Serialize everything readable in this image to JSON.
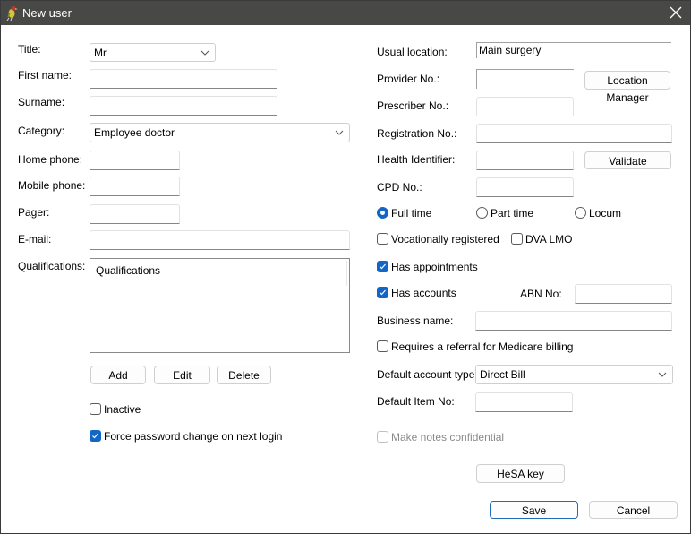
{
  "window": {
    "title": "New user",
    "app_icon": "bird-app-icon",
    "close_icon": "close-icon"
  },
  "left": {
    "title": {
      "label": "Title:",
      "value": "Mr"
    },
    "first_name": {
      "label": "First name:",
      "value": ""
    },
    "surname": {
      "label": "Surname:",
      "value": ""
    },
    "category": {
      "label": "Category:",
      "value": "Employee doctor"
    },
    "home_phone": {
      "label": "Home phone:",
      "value": ""
    },
    "mobile_phone": {
      "label": "Mobile phone:",
      "value": ""
    },
    "pager": {
      "label": "Pager:",
      "value": ""
    },
    "email": {
      "label": "E-mail:",
      "value": ""
    },
    "qualifications": {
      "label": "Qualifications:",
      "items": [
        "Qualifications"
      ]
    },
    "buttons": {
      "add": "Add",
      "edit": "Edit",
      "delete": "Delete"
    },
    "inactive": {
      "label": "Inactive",
      "checked": false
    },
    "force_password": {
      "label": "Force password change on next login",
      "checked": true
    }
  },
  "right": {
    "usual_location": {
      "label": "Usual location:",
      "value": "Main surgery"
    },
    "provider_no": {
      "label": "Provider No.:",
      "value": ""
    },
    "location_manager_button": "Location Manager",
    "prescriber_no": {
      "label": "Prescriber No.:",
      "value": ""
    },
    "registration_no": {
      "label": "Registration No.:",
      "value": ""
    },
    "health_identifier": {
      "label": "Health Identifier:",
      "value": ""
    },
    "validate_button": "Validate",
    "cpd_no": {
      "label": "CPD No.:",
      "value": ""
    },
    "employment": {
      "options": [
        "Full time",
        "Part time",
        "Locum"
      ],
      "selected": "Full time"
    },
    "vocationally_registered": {
      "label": "Vocationally registered",
      "checked": false
    },
    "dva_lmo": {
      "label": "DVA LMO",
      "checked": false
    },
    "has_appointments": {
      "label": "Has appointments",
      "checked": true
    },
    "has_accounts": {
      "label": "Has accounts",
      "checked": true
    },
    "abn_no": {
      "label": "ABN No:",
      "value": ""
    },
    "business_name": {
      "label": "Business name:",
      "value": ""
    },
    "requires_referral": {
      "label": "Requires a referral for Medicare billing",
      "checked": false
    },
    "default_account_type": {
      "label": "Default account type:",
      "value": "Direct Bill"
    },
    "default_item_no": {
      "label": "Default Item No:",
      "value": ""
    },
    "make_notes_confidential": {
      "label": "Make notes confidential",
      "checked": false,
      "disabled": true
    },
    "hesa_key_button": "HeSA key"
  },
  "footer": {
    "save": "Save",
    "cancel": "Cancel"
  },
  "colors": {
    "titlebar": "#484846",
    "accent": "#1366c4"
  }
}
